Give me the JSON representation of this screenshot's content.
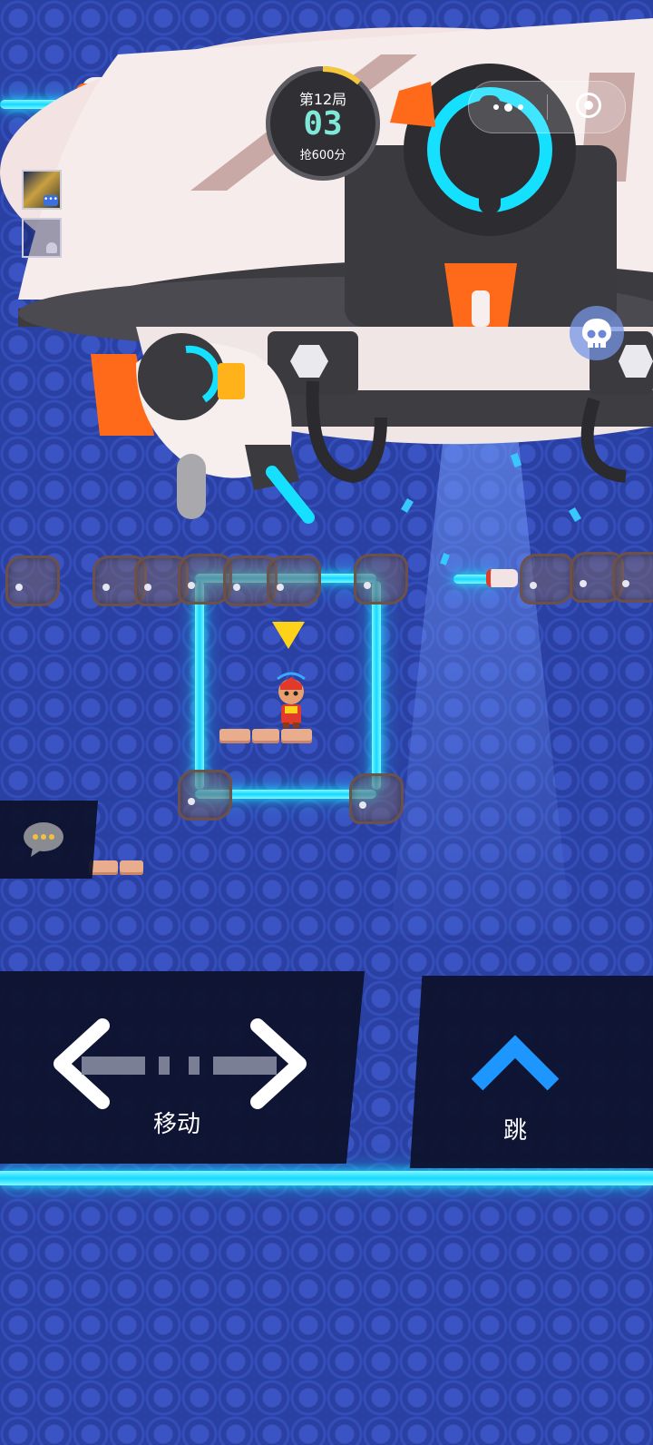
{
  "hud": {
    "round_label": "第12局",
    "count": "03",
    "score_label": "抢600分"
  },
  "controls": {
    "move_label": "移动",
    "jump_label": "跳"
  },
  "colors": {
    "laser": "#18e2ff",
    "jump_arrow": "#1e96ff",
    "hud_count": "#7fe8d8",
    "hud_ring": "#f5c73a"
  },
  "icons": {
    "menu": "more-dots-icon",
    "close": "target-circle-icon",
    "skull": "skull-icon",
    "chat": "chat-bubble-icon",
    "left": "arrow-left-icon",
    "right": "arrow-right-icon",
    "jump": "chevron-up-icon"
  }
}
